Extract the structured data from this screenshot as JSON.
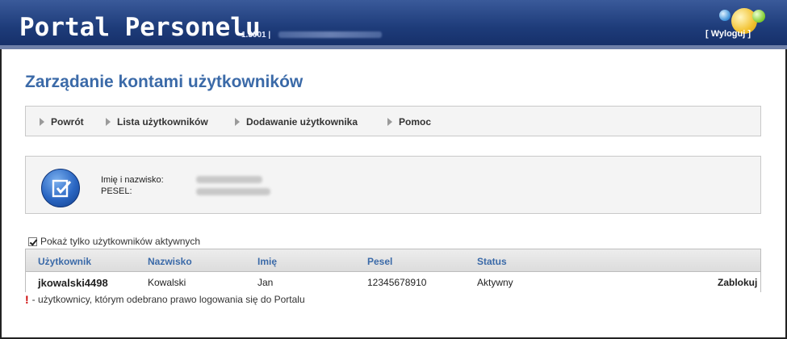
{
  "header": {
    "app_title": "Portal Personelu",
    "version": "1.3001 |",
    "logout_label": "[ Wyloguj ]"
  },
  "page": {
    "title": "Zarządanie kontami użytkowników"
  },
  "menu": {
    "items": [
      {
        "label": "Powrót"
      },
      {
        "label": "Lista użytkowników"
      },
      {
        "label": "Dodawanie użytkownika"
      },
      {
        "label": "Pomoc"
      }
    ]
  },
  "info": {
    "name_label": "Imię i nazwisko:",
    "pesel_label": "PESEL:"
  },
  "filter": {
    "label": "Pokaż tylko użytkowników aktywnych",
    "checked": true
  },
  "table": {
    "columns": [
      "Użytkownik",
      "Nazwisko",
      "Imię",
      "Pesel",
      "Status"
    ],
    "rows": [
      {
        "user": "jkowalski4498",
        "surname": "Kowalski",
        "name": "Jan",
        "pesel": "12345678910",
        "status": "Aktywny",
        "action": "Zablokuj"
      }
    ]
  },
  "legend": {
    "text": "- użytkownicy, którym odebrano prawo logowania się do Portalu"
  },
  "icons": {
    "info_icon": "edit-check-icon",
    "menu_bullet": "triangle-right-icon"
  },
  "colors": {
    "header_bg": "#1e3c7a",
    "accent": "#3b6aa8",
    "warning": "#cc0000"
  }
}
